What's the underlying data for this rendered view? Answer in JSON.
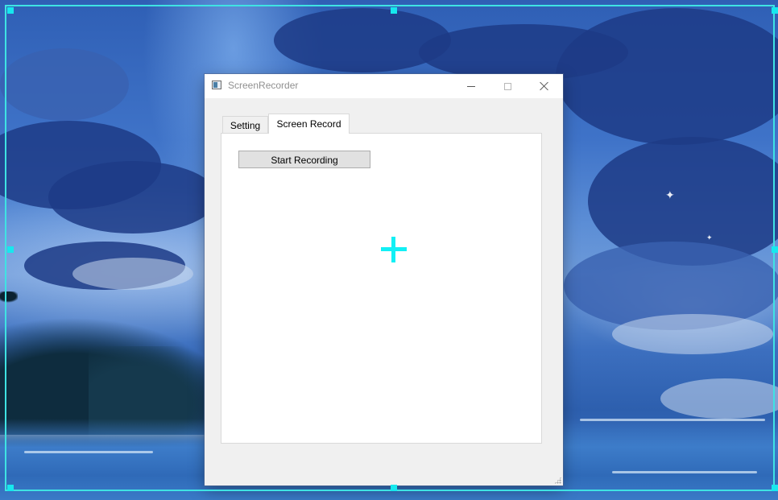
{
  "window": {
    "title": "ScreenRecorder",
    "icon": "app-icon",
    "controls": {
      "minimize_icon": "minimize-icon",
      "maximize_icon": "maximize-icon",
      "close_icon": "close-icon"
    }
  },
  "tabs": [
    {
      "label": "Setting",
      "selected": false
    },
    {
      "label": "Screen Record",
      "selected": true
    }
  ],
  "screen_record": {
    "start_button_label": "Start Recording"
  },
  "overlay": {
    "selection_color": "#16e8ee",
    "crosshair_icon": "crosshair-icon"
  }
}
